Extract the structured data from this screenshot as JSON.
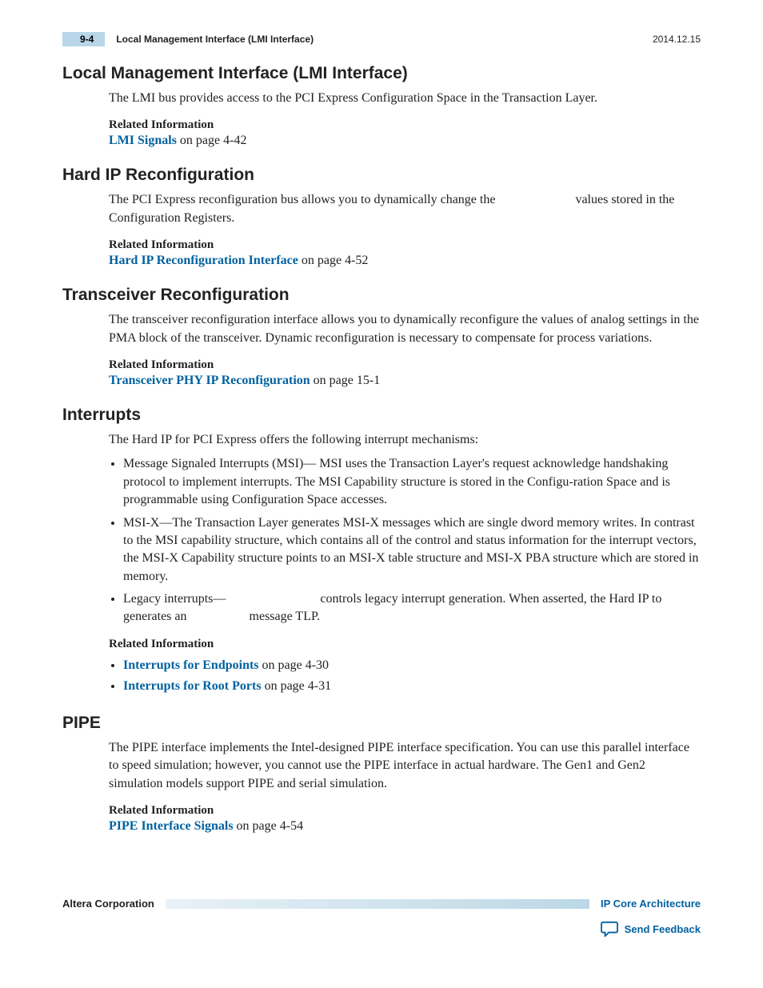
{
  "header": {
    "page_num": "9-4",
    "running_title": "Local Management Interface (LMI Interface)",
    "date": "2014.12.15"
  },
  "sections": {
    "lmi": {
      "title": "Local Management Interface (LMI Interface)",
      "body": "The LMI bus provides access to the PCI Express Configuration Space in the Transaction Layer.",
      "rel_head": "Related Information",
      "link_text": "LMI Signals",
      "link_tail": " on page 4-42"
    },
    "hardip": {
      "title": "Hard IP Reconfiguration",
      "body_a": "The PCI Express reconfiguration bus allows you to dynamically change the ",
      "body_b": " values stored in the Configuration Registers.",
      "rel_head": "Related Information",
      "link_text": "Hard IP Reconfiguration Interface",
      "link_tail": " on page 4-52"
    },
    "xcvr": {
      "title": "Transceiver Reconfiguration",
      "body": "The transceiver reconfiguration interface allows you to dynamically reconfigure the values of analog settings in the PMA block of the transceiver. Dynamic reconfiguration is necessary to compensate for process variations.",
      "rel_head": "Related Information",
      "link_text": "Transceiver PHY IP Reconfiguration",
      "link_tail": " on page 15-1"
    },
    "interrupts": {
      "title": "Interrupts",
      "intro": "The Hard IP for PCI Express offers the following interrupt mechanisms:",
      "b1": "Message Signaled Interrupts (MSI)— MSI uses the Transaction Layer's request  acknowledge handshaking protocol to implement interrupts. The MSI Capability structure is stored in the Configu‐ration Space and is programmable using Configuration Space accesses.",
      "b2": "MSI-X—The Transaction Layer generates MSI-X messages which are single dword memory writes. In contrast to the MSI capability structure, which contains all of the control and status information for the interrupt vectors, the MSI‑X Capability structure points to an MSI‑X table structure and MSI‑X PBA structure which are stored in memory.",
      "b3a": "Legacy interrupts—",
      "b3b": "controls legacy interrupt generation. When asserted, the Hard IP to generates an",
      "b3c": "message TLP.",
      "rel_head": "Related Information",
      "rel1_link": "Interrupts for Endpoints",
      "rel1_tail": " on page 4-30",
      "rel2_link": "Interrupts for Root Ports",
      "rel2_tail": " on page 4-31"
    },
    "pipe": {
      "title": "PIPE",
      "body": "The PIPE interface implements the Intel‑designed PIPE interface specification. You can use this parallel interface to speed simulation; however, you cannot use the PIPE interface in actual hardware. The Gen1 and Gen2 simulation models support PIPE and serial simulation.",
      "rel_head": "Related Information",
      "link_text": "PIPE Interface Signals",
      "link_tail": " on page 4-54"
    }
  },
  "footer": {
    "corp": "Altera Corporation",
    "arch_link": "IP Core Architecture",
    "feedback": "Send Feedback"
  }
}
